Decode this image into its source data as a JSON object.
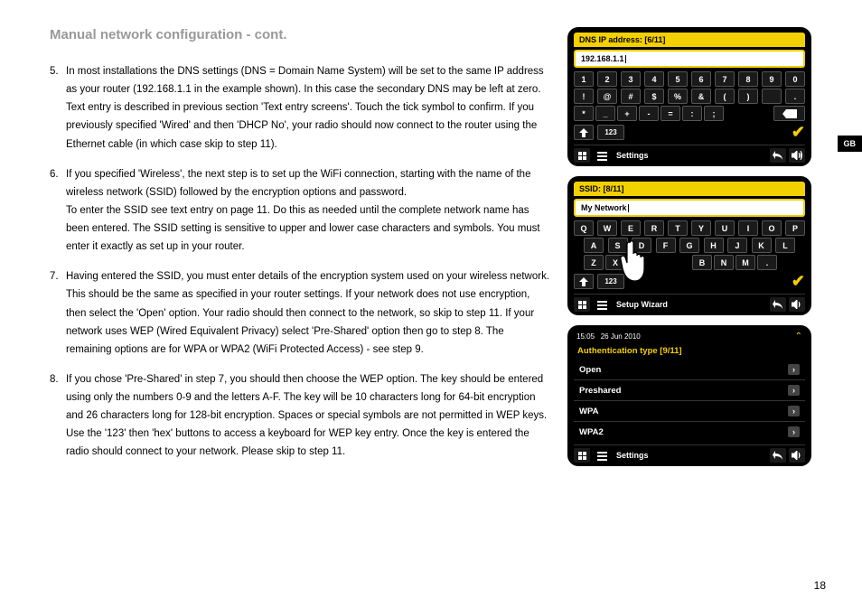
{
  "title": "Manual network configuration - cont.",
  "lang_tab": "GB",
  "page_number": "18",
  "steps": [
    {
      "n": "5.",
      "text": "In most installations the DNS settings (DNS = Domain Name System) will be set to the same IP address as your router (192.168.1.1 in the example shown). In this case the secondary DNS may be left at zero.\nText entry is described in previous section 'Text entry screens'. Touch the tick symbol to confirm. If you previously specified 'Wired' and then 'DHCP No', your radio should now connect to the router using the Ethernet cable (in which case skip to step 11)."
    },
    {
      "n": "6.",
      "text": "If you specified 'Wireless', the next step is to set up the WiFi connection, starting with the name of the wireless network (SSID) followed by the encryption options and password.\nTo enter the SSID see text entry on page 11. Do this as needed until the complete network name has been entered. The SSID setting is sensitive to upper and lower case characters and symbols. You must enter it exactly as set up in your router."
    },
    {
      "n": "7.",
      "text": "Having entered the SSID, you must enter details of the encryption system used on your wireless network. This should be the same as specified in your router settings. If your network does not use encryption, then select the 'Open' option. Your radio should then connect to the network, so skip to step 11. If your network uses WEP (Wired Equivalent Privacy) select 'Pre-Shared' option then go to step 8. The remaining options are for WPA or WPA2 (WiFi Protected Access) - see step 9."
    },
    {
      "n": "8.",
      "text": "If you chose 'Pre-Shared' in step 7, you should then choose the WEP option. The key should be entered using only the numbers 0-9 and the letters A-F. The key will be 10 characters long for 64-bit encryption and 26 characters long for 128-bit encryption. Spaces or special symbols are not permitted in WEP keys. Use the '123' then 'hex' buttons to access a keyboard for WEP key entry. Once the key is entered the radio should connect to your network. Please skip to step 11."
    }
  ],
  "screen1": {
    "header": "DNS IP address: [6/11]",
    "input": "192.168.1.1",
    "row1": [
      "1",
      "2",
      "3",
      "4",
      "5",
      "6",
      "7",
      "8",
      "9",
      "0"
    ],
    "row2": [
      "!",
      "@",
      "#",
      "$",
      "%",
      "&",
      "(",
      ")",
      "",
      "."
    ],
    "row3": [
      "*",
      "_",
      "+",
      "-",
      "=",
      ":",
      ";"
    ],
    "mode": "123",
    "footer": "Settings"
  },
  "screen2": {
    "header": "SSID: [8/11]",
    "input": "My Network",
    "row1": [
      "Q",
      "W",
      "E",
      "R",
      "T",
      "Y",
      "U",
      "I",
      "O",
      "P"
    ],
    "row2": [
      "A",
      "S",
      "D",
      "F",
      "G",
      "H",
      "J",
      "K",
      "L"
    ],
    "row3": [
      "Z",
      "X",
      "",
      "",
      "",
      "B",
      "N",
      "M",
      "."
    ],
    "mode": "123",
    "footer": "Setup Wizard"
  },
  "screen3": {
    "time": "15:05",
    "date": "26 Jun 2010",
    "header": "Authentication type [9/11]",
    "items": [
      "Open",
      "Preshared",
      "WPA",
      "WPA2"
    ],
    "footer": "Settings"
  }
}
